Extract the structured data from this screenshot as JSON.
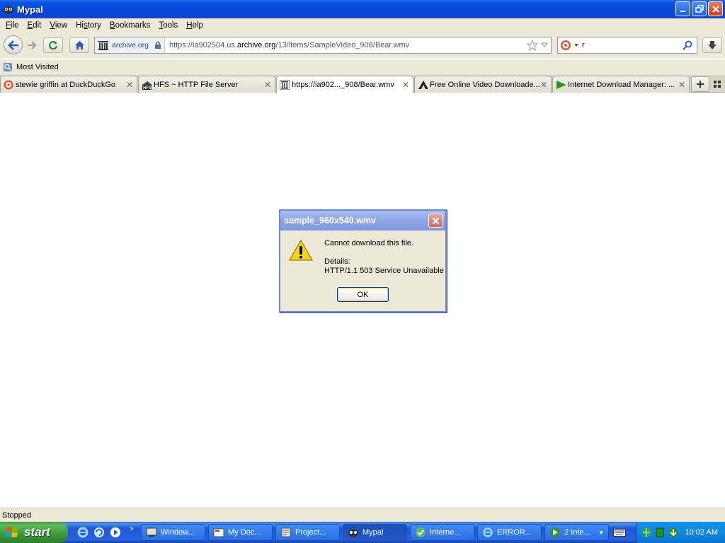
{
  "window": {
    "title": "Mypal"
  },
  "menu": [
    {
      "pre": "",
      "u": "F",
      "post": "ile"
    },
    {
      "pre": "",
      "u": "E",
      "post": "dit"
    },
    {
      "pre": "",
      "u": "V",
      "post": "iew"
    },
    {
      "pre": "Hi",
      "u": "s",
      "post": "tory"
    },
    {
      "pre": "",
      "u": "B",
      "post": "ookmarks"
    },
    {
      "pre": "",
      "u": "T",
      "post": "ools"
    },
    {
      "pre": "",
      "u": "H",
      "post": "elp"
    }
  ],
  "urlbar": {
    "site_identity": "archive.org",
    "url_prefix": "https://ia902504.us.",
    "url_domain": "archive.org",
    "url_suffix": "/13/items/SampleVideo_908/Bear.wmv"
  },
  "search": {
    "value": "r"
  },
  "bookmarks": [
    {
      "label": "Most Visited"
    }
  ],
  "tabs": [
    {
      "label": "stewie griffin at DuckDuckGo",
      "icon": "duckduckgo-icon",
      "active": false
    },
    {
      "label": "HFS ~ HTTP File Server",
      "icon": "hfs-icon",
      "active": false
    },
    {
      "label": "https://ia902..._908/Bear.wmv",
      "icon": "archive-icon",
      "active": true
    },
    {
      "label": "Free Online Video Downloade...",
      "icon": "triangle-icon",
      "active": false
    },
    {
      "label": "Internet Download Manager: ...",
      "icon": "idm-play-icon",
      "active": false
    }
  ],
  "dialog": {
    "title": "sample_960x540.wmv",
    "message": "Cannot download this file.",
    "details_label": "Details:",
    "details_text": "HTTP/1.1 503 Service Unavailable",
    "ok_label": "OK"
  },
  "status": "Stopped",
  "taskbar": {
    "start_label": "start",
    "tasks": [
      {
        "label": "Window...",
        "icon": "windows-explorer-icon"
      },
      {
        "label": "My Doc...",
        "icon": "folder-icon"
      },
      {
        "label": "Project...",
        "icon": "project-icon"
      },
      {
        "label": "Mypal",
        "icon": "mypal-icon",
        "active": true
      },
      {
        "label": "Interne...",
        "icon": "internet-icon"
      },
      {
        "label": "ERROR...",
        "icon": "ie-icon"
      },
      {
        "label": "2 Inte...",
        "icon": "idm-icon"
      }
    ],
    "clock": "10:02 AM"
  }
}
